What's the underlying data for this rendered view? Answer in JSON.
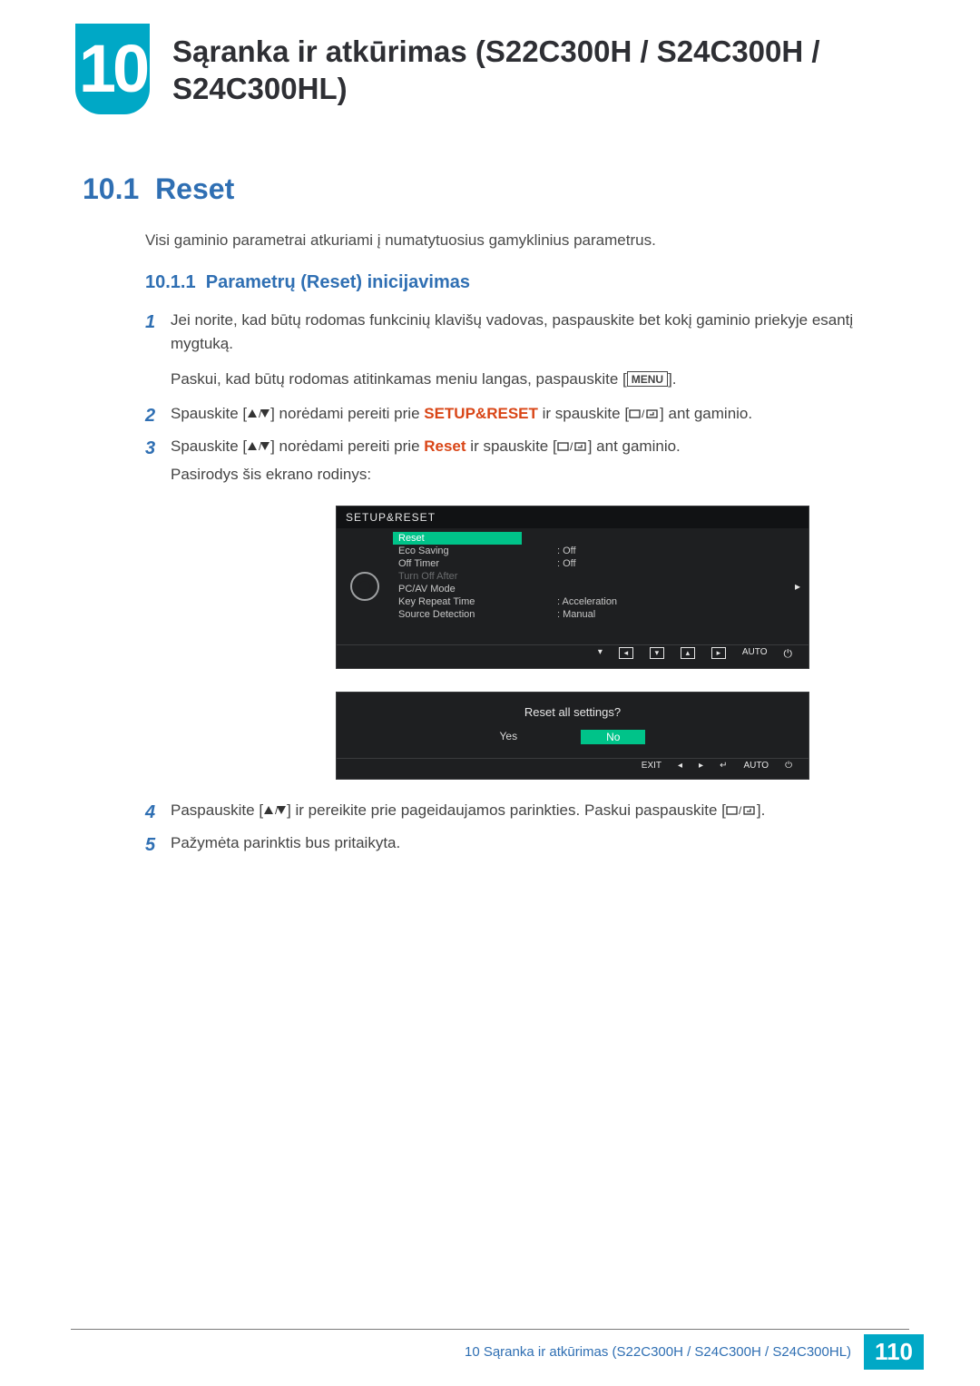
{
  "chapter_num": "10",
  "chapter_title": "Sąranka ir atkūrimas (S22C300H / S24C300H / S24C300HL)",
  "section": {
    "num": "10.1",
    "title": "Reset",
    "desc": "Visi gaminio parametrai atkuriami į numatytuosius gamyklinius parametrus."
  },
  "subsection": {
    "num": "10.1.1",
    "title": "Parametrų (Reset) inicijavimas"
  },
  "steps": {
    "s1a": "Jei norite, kad būtų rodomas funkcinių klavišų vadovas, paspauskite bet kokį gaminio priekyje esantį mygtuką.",
    "s1b_pre": "Paskui, kad būtų rodomas atitinkamas meniu langas, paspauskite [",
    "s1b_menu": "MENU",
    "s1b_post": "].",
    "s2_pre": "Spauskite [",
    "s2_mid": "] norėdami pereiti prie ",
    "s2_hl": "SETUP&RESET",
    "s2_post1": " ir spauskite [",
    "s2_post2": "] ant gaminio.",
    "s3_pre": "Spauskite [",
    "s3_mid": "] norėdami pereiti prie ",
    "s3_hl": "Reset",
    "s3_post1": " ir spauskite [",
    "s3_post2": "] ant gaminio.",
    "s3_tail": "Pasirodys šis ekrano rodinys:",
    "s4_pre": "Paspauskite [",
    "s4_mid": "] ir pereikite prie pageidaujamos parinkties. Paskui paspauskite [",
    "s4_post": "].",
    "s5": "Pažymėta parinktis bus pritaikyta."
  },
  "osd": {
    "title": "SETUP&RESET",
    "items": [
      {
        "label": "Reset",
        "value": "",
        "highlight": true
      },
      {
        "label": "Eco Saving",
        "value": "Off"
      },
      {
        "label": "Off Timer",
        "value": "Off"
      },
      {
        "label": "Turn Off After",
        "value": "",
        "dim": true
      },
      {
        "label": "PC/AV Mode",
        "value": ""
      },
      {
        "label": "Key Repeat Time",
        "value": "Acceleration"
      },
      {
        "label": "Source Detection",
        "value": "Manual"
      }
    ],
    "nav_auto": "AUTO"
  },
  "confirm": {
    "question": "Reset all settings?",
    "yes": "Yes",
    "no": "No",
    "exit": "EXIT",
    "auto": "AUTO"
  },
  "footer": {
    "crumb": "10 Sąranka ir atkūrimas (S22C300H / S24C300H / S24C300HL)",
    "page": "110"
  }
}
